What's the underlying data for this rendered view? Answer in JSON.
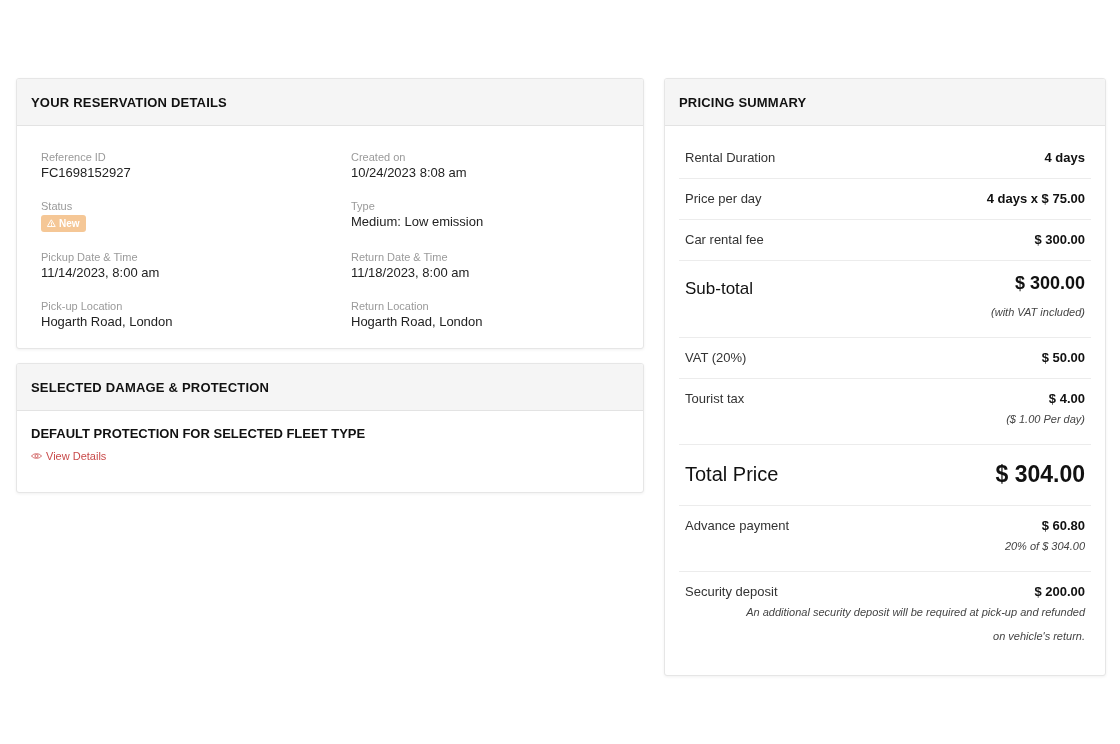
{
  "reservation": {
    "title": "YOUR RESERVATION DETAILS",
    "fields": [
      {
        "kind": "text",
        "label": "Reference ID",
        "value": "FC1698152927"
      },
      {
        "kind": "text",
        "label": "Created on",
        "value": "10/24/2023 8:08 am"
      },
      {
        "kind": "badge",
        "label": "Status",
        "value": "New"
      },
      {
        "kind": "text",
        "label": "Type",
        "value": "Medium: Low emission"
      },
      {
        "kind": "text",
        "label": "Pickup Date & Time",
        "value": "11/14/2023, 8:00 am"
      },
      {
        "kind": "text",
        "label": "Return Date & Time",
        "value": "11/18/2023, 8:00 am"
      },
      {
        "kind": "text",
        "label": "Pick-up Location",
        "value": "Hogarth Road, London"
      },
      {
        "kind": "text",
        "label": "Return Location",
        "value": "Hogarth Road, London"
      }
    ]
  },
  "protection": {
    "title": "SELECTED DAMAGE & PROTECTION",
    "heading": "DEFAULT PROTECTION FOR SELECTED FLEET TYPE",
    "link": "View Details"
  },
  "pricing": {
    "title": "PRICING SUMMARY",
    "rows": [
      {
        "kind": "regular",
        "label": "Rental Duration",
        "value": "4 days"
      },
      {
        "kind": "regular",
        "label": "Price per day",
        "value": "4 days x $ 75.00"
      },
      {
        "kind": "regular",
        "label": "Car rental fee",
        "value": "$ 300.00"
      },
      {
        "kind": "subtotal",
        "label": "Sub-total",
        "value": "$ 300.00",
        "note": "(with VAT included)"
      },
      {
        "kind": "regular",
        "label": "VAT (20%)",
        "value": "$ 50.00"
      },
      {
        "kind": "regular",
        "label": "Tourist tax",
        "value": "$ 4.00",
        "note": "($ 1.00 Per day)"
      },
      {
        "kind": "total",
        "label": "Total Price",
        "value": "$ 304.00"
      },
      {
        "kind": "regular",
        "label": "Advance payment",
        "value": "$ 60.80",
        "note": "20% of $ 304.00"
      },
      {
        "kind": "regular",
        "label": "Security deposit",
        "value": "$ 200.00",
        "note": "An additional security deposit will be required at pick-up and refunded on vehicle's return."
      }
    ]
  }
}
